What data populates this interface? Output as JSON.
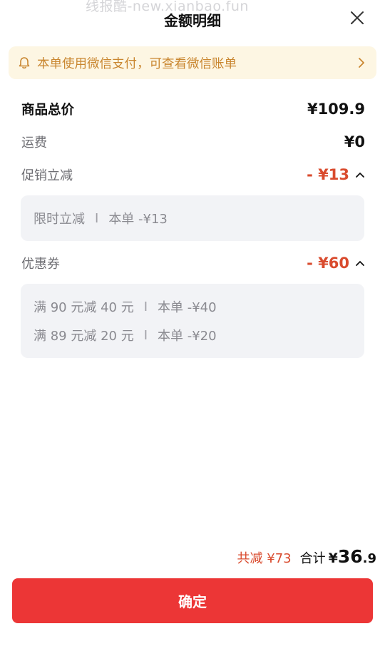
{
  "watermark": "线报酷-new.xianbao.fun",
  "header": {
    "title": "金额明细",
    "close_icon": "close-icon"
  },
  "notice": {
    "text": "本单使用微信支付，可查看微信账单",
    "color": "#c9862f",
    "background": "#fdf6e3"
  },
  "rows": {
    "goods_total": {
      "label": "商品总价",
      "value": "¥109.9"
    },
    "shipping": {
      "label": "运费",
      "value": "¥0"
    },
    "promotion": {
      "label": "促销立减",
      "value": "- ¥13",
      "expanded": true,
      "details": [
        {
          "name": "限时立减",
          "sep": "I",
          "amount": "本单 -¥13"
        }
      ]
    },
    "coupon": {
      "label": "优惠券",
      "value": "- ¥60",
      "expanded": true,
      "details": [
        {
          "name": "满 90 元减 40 元",
          "sep": "I",
          "amount": "本单 -¥40"
        },
        {
          "name": "满 89 元减 20 元",
          "sep": "I",
          "amount": "本单 -¥20"
        }
      ]
    }
  },
  "summary": {
    "saved": "共减 ¥73",
    "total_label": "合计",
    "currency": "¥",
    "total_int": "36",
    "total_dec": ".9"
  },
  "confirm": {
    "label": "确定",
    "color": "#ec3636"
  },
  "colors": {
    "accent_red": "#d94b2e",
    "detail_bg": "#f2f3f6"
  }
}
